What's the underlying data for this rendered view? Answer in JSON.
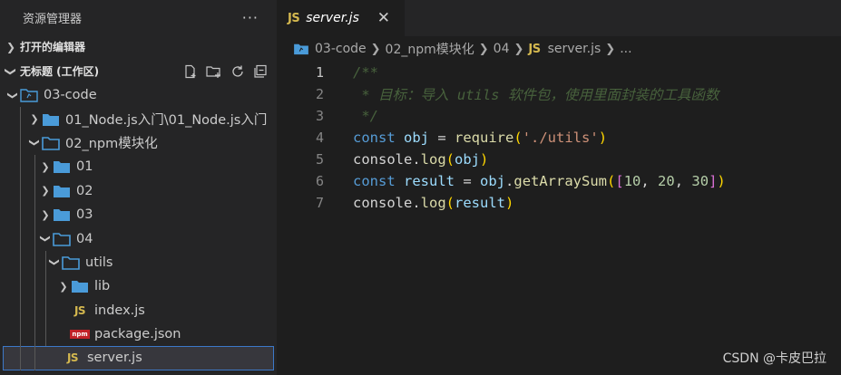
{
  "sidebar": {
    "title": "资源管理器",
    "more": "···",
    "open_editors": "打开的编辑器",
    "workspace": "无标题 (工作区)",
    "tree": [
      {
        "label": "03-code",
        "depth": 0,
        "chevron": "open",
        "icon": "workspace-folder-icon"
      },
      {
        "label": "01_Node.js入门\\01_Node.js入门",
        "depth": 1,
        "chevron": "closed",
        "icon": "folder-icon"
      },
      {
        "label": "02_npm模块化",
        "depth": 1,
        "chevron": "open",
        "icon": "folder-open-icon"
      },
      {
        "label": "01",
        "depth": 2,
        "chevron": "closed",
        "icon": "folder-icon"
      },
      {
        "label": "02",
        "depth": 2,
        "chevron": "closed",
        "icon": "folder-icon"
      },
      {
        "label": "03",
        "depth": 2,
        "chevron": "closed",
        "icon": "folder-icon"
      },
      {
        "label": "04",
        "depth": 2,
        "chevron": "open",
        "icon": "folder-open-icon"
      },
      {
        "label": "utils",
        "depth": 3,
        "chevron": "open",
        "icon": "folder-open-icon"
      },
      {
        "label": "lib",
        "depth": 4,
        "chevron": "closed",
        "icon": "folder-icon"
      },
      {
        "label": "index.js",
        "depth": 4,
        "chevron": "none",
        "icon": "js-file-icon"
      },
      {
        "label": "package.json",
        "depth": 4,
        "chevron": "none",
        "icon": "npm-file-icon"
      },
      {
        "label": "server.js",
        "depth": 3,
        "chevron": "none",
        "icon": "js-file-icon",
        "selected": true
      }
    ]
  },
  "tab": {
    "label": "server.js",
    "icon_text": "JS",
    "close": "✕"
  },
  "breadcrumb": {
    "items": [
      "03-code",
      "02_npm模块化",
      "04",
      "server.js",
      "..."
    ],
    "js_icon": "JS"
  },
  "code": {
    "line_numbers": [
      "1",
      "2",
      "3",
      "4",
      "5",
      "6",
      "7"
    ],
    "line1": "/**",
    "line2": " * 目标：导入 utils 软件包，使用里面封装的工具函数",
    "line3": " */",
    "const": "const",
    "obj": "obj",
    "eq": " = ",
    "require": "require",
    "req_arg": "'./utils'",
    "console": "console",
    "log": "log",
    "result": "result",
    "getArraySum": "getArraySum",
    "n10": "10",
    "n20": "20",
    "n30": "30"
  },
  "watermark": "CSDN @卡皮巴拉",
  "colors": {
    "folder": "#4a9bd9",
    "js": "#d4b84f",
    "accent": "#3c78c8"
  }
}
